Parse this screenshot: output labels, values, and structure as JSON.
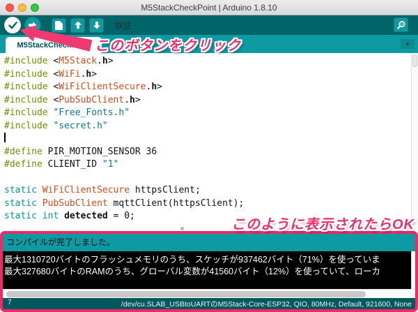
{
  "window": {
    "title": "M5StackCheckPoint | Arduino 1.8.10"
  },
  "toolbar": {
    "verify_tooltip": "検証",
    "buttons": [
      "verify",
      "upload",
      "new",
      "open",
      "save",
      "serial-monitor"
    ]
  },
  "tab": {
    "label": "M5StackCheckPoint"
  },
  "annotations": {
    "click_button": "このボタンをクリック",
    "ok_message": "このように表示されたらOK",
    "accent_color": "#ee2a67"
  },
  "editor": {
    "lines": [
      {
        "tokens": [
          {
            "t": "#include",
            "c": "pre"
          },
          {
            "t": " <",
            "c": "n"
          },
          {
            "t": "M5Stack",
            "c": "o"
          },
          {
            "t": ".",
            "c": "n"
          },
          {
            "t": "h",
            "c": "b"
          },
          {
            "t": ">",
            "c": "n"
          }
        ]
      },
      {
        "tokens": [
          {
            "t": "#include",
            "c": "pre"
          },
          {
            "t": " <",
            "c": "n"
          },
          {
            "t": "WiFi",
            "c": "o"
          },
          {
            "t": ".",
            "c": "n"
          },
          {
            "t": "h",
            "c": "b"
          },
          {
            "t": ">",
            "c": "n"
          }
        ]
      },
      {
        "tokens": [
          {
            "t": "#include",
            "c": "pre"
          },
          {
            "t": " <",
            "c": "n"
          },
          {
            "t": "WiFiClientSecure",
            "c": "o"
          },
          {
            "t": ".",
            "c": "n"
          },
          {
            "t": "h",
            "c": "b"
          },
          {
            "t": ">",
            "c": "n"
          }
        ]
      },
      {
        "tokens": [
          {
            "t": "#include",
            "c": "pre"
          },
          {
            "t": " <",
            "c": "n"
          },
          {
            "t": "PubSubClient",
            "c": "o"
          },
          {
            "t": ".",
            "c": "n"
          },
          {
            "t": "h",
            "c": "b"
          },
          {
            "t": ">",
            "c": "n"
          }
        ]
      },
      {
        "tokens": [
          {
            "t": "#include",
            "c": "pre"
          },
          {
            "t": " ",
            "c": "n"
          },
          {
            "t": "\"Free_Fonts.h\"",
            "c": "s"
          }
        ]
      },
      {
        "tokens": [
          {
            "t": "#include",
            "c": "pre"
          },
          {
            "t": " ",
            "c": "n"
          },
          {
            "t": "\"secret.h\"",
            "c": "s"
          }
        ]
      },
      {
        "tokens": [],
        "cursor": true
      },
      {
        "tokens": [
          {
            "t": "#define",
            "c": "pre"
          },
          {
            "t": " PIR_MOTION_SENSOR 36",
            "c": "n"
          }
        ]
      },
      {
        "tokens": [
          {
            "t": "#define",
            "c": "pre"
          },
          {
            "t": " CLIENT_ID ",
            "c": "n"
          },
          {
            "t": "\"1\"",
            "c": "s"
          }
        ]
      },
      {
        "tokens": []
      },
      {
        "tokens": [
          {
            "t": "static",
            "c": "k"
          },
          {
            "t": " ",
            "c": "n"
          },
          {
            "t": "WiFiClientSecure",
            "c": "o"
          },
          {
            "t": " httpsClient;",
            "c": "n"
          }
        ]
      },
      {
        "tokens": [
          {
            "t": "static",
            "c": "k"
          },
          {
            "t": " ",
            "c": "n"
          },
          {
            "t": "PubSubClient",
            "c": "o"
          },
          {
            "t": " mqttClient(httpsClient);",
            "c": "n"
          }
        ]
      },
      {
        "tokens": [
          {
            "t": "static",
            "c": "k"
          },
          {
            "t": " ",
            "c": "n"
          },
          {
            "t": "int",
            "c": "k"
          },
          {
            "t": " ",
            "c": "n"
          },
          {
            "t": "detected",
            "c": "b"
          },
          {
            "t": " = 0;",
            "c": "n"
          }
        ]
      }
    ]
  },
  "console": {
    "status": "コンパイルが完了しました。",
    "output": [
      "最大1310720バイトのフラッシュメモリのうち、スケッチが937462バイト（71%）を使っていま",
      "最大327680バイトのRAMのうち、グローバル変数が41560バイト（12%）を使っていて、ローカ"
    ]
  },
  "statusbar": {
    "line_number": "7",
    "board_info": "/dev/cu.SLAB_USBtoUARTのM5Stack-Core-ESP32, QIO, 80MHz, Default, 921600, None"
  },
  "colors": {
    "toolbar": "#006468",
    "tabbar": "#0d9aa3",
    "status_strip": "#0d9aa3",
    "bottom_bar": "#02585c",
    "console_bg": "#000000",
    "accent_pink": "#ee2a67",
    "keyword_teal": "#00979c",
    "type_orange": "#d8491b",
    "preproc_olive": "#728e00",
    "string_teal": "#067b84"
  }
}
